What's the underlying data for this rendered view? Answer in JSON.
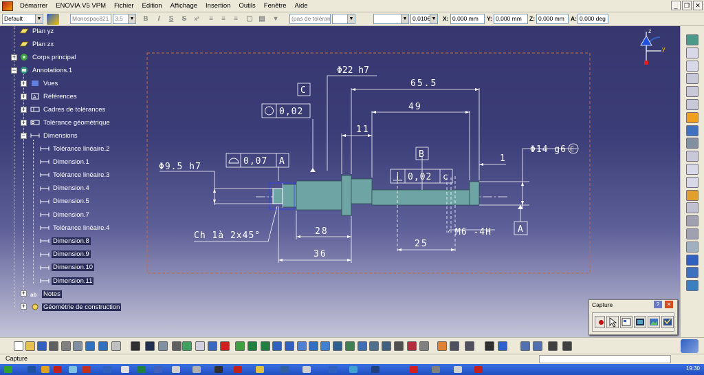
{
  "menu": {
    "items": [
      "Démarrer",
      "ENOVIA V5 VPM",
      "Fichier",
      "Edition",
      "Affichage",
      "Insertion",
      "Outils",
      "Fenêtre",
      "Aide"
    ]
  },
  "format_bar": {
    "style_combo": "Default",
    "font_combo": "Monospac821",
    "size_combo": "3,5",
    "tolerance_combo": "(pas de toléranc",
    "precision_combo": "0,010€",
    "x_label": "X:",
    "x_value": "0,000 mm",
    "y_label": "Y:",
    "y_value": "0,000 mm",
    "z_label": "Z:",
    "z_value": "0,000 mm",
    "a_label": "A:",
    "a_value": "0,000 deg",
    "bold": "B",
    "italic": "I",
    "underline": "S",
    "strike": "S",
    "superscript": "x²"
  },
  "tree": {
    "items": [
      {
        "label": "Plan yz",
        "icon": "plane-icon"
      },
      {
        "label": "Plan zx",
        "icon": "plane-icon"
      },
      {
        "label": "Corps principal",
        "icon": "body-icon"
      },
      {
        "label": "Annotations.1",
        "icon": "annotation-set-icon"
      },
      {
        "label": "Vues",
        "icon": "views-icon"
      },
      {
        "label": "Références",
        "icon": "references-icon"
      },
      {
        "label": "Cadres de tolérances",
        "icon": "tolerance-frames-icon"
      },
      {
        "label": "Tolérance géométrique",
        "icon": "geometric-tolerance-icon"
      },
      {
        "label": "Dimensions",
        "icon": "dimensions-icon"
      },
      {
        "label": "Tolérance linéaire.2",
        "icon": "dimension-icon"
      },
      {
        "label": "Dimension.1",
        "icon": "dimension-icon"
      },
      {
        "label": "Tolérance linéaire.3",
        "icon": "dimension-icon"
      },
      {
        "label": "Dimension.4",
        "icon": "dimension-icon"
      },
      {
        "label": "Dimension.5",
        "icon": "dimension-icon"
      },
      {
        "label": "Dimension.7",
        "icon": "dimension-icon"
      },
      {
        "label": "Tolérance linéaire.4",
        "icon": "dimension-icon"
      },
      {
        "label": "Dimension.8",
        "icon": "dimension-icon"
      },
      {
        "label": "Dimension.9",
        "icon": "dimension-icon"
      },
      {
        "label": "Dimension.10",
        "icon": "dimension-icon"
      },
      {
        "label": "Dimension.11",
        "icon": "dimension-icon"
      },
      {
        "label": "Notes",
        "icon": "notes-icon"
      },
      {
        "label": "Géométrie de construction",
        "icon": "construction-geometry-icon"
      }
    ]
  },
  "drawing": {
    "dim_22": "Φ22 h7",
    "dim_65": "65.5",
    "dim_49": "49",
    "dim_11": "11",
    "dim_1": "1",
    "dim_14": "Φ14 g6",
    "dim_14_mod": "E",
    "dim_9": "Φ9.5 h7",
    "dim_28": "28",
    "dim_36": "36",
    "dim_25": "25",
    "thread": "M6 -4H",
    "chamfer": "Ch 1à 2x45°",
    "datum_c": "C",
    "datum_b": "B",
    "datum_a": "A",
    "fcf_roundness_value": "0,02",
    "fcf_profile_value": "0,07",
    "fcf_profile_ref": "A",
    "fcf_perp_value": "0,02",
    "fcf_perp_ref": "c"
  },
  "compass": {
    "z": "z",
    "y": "y"
  },
  "capture": {
    "title": "Capture",
    "help": "?"
  },
  "status": {
    "text": "Capture"
  },
  "taskbar": {
    "clock": "19:30"
  },
  "colors": {
    "viewport_top": "#36376e",
    "part": "#6fa4a4",
    "frame": "#c86a3c"
  }
}
